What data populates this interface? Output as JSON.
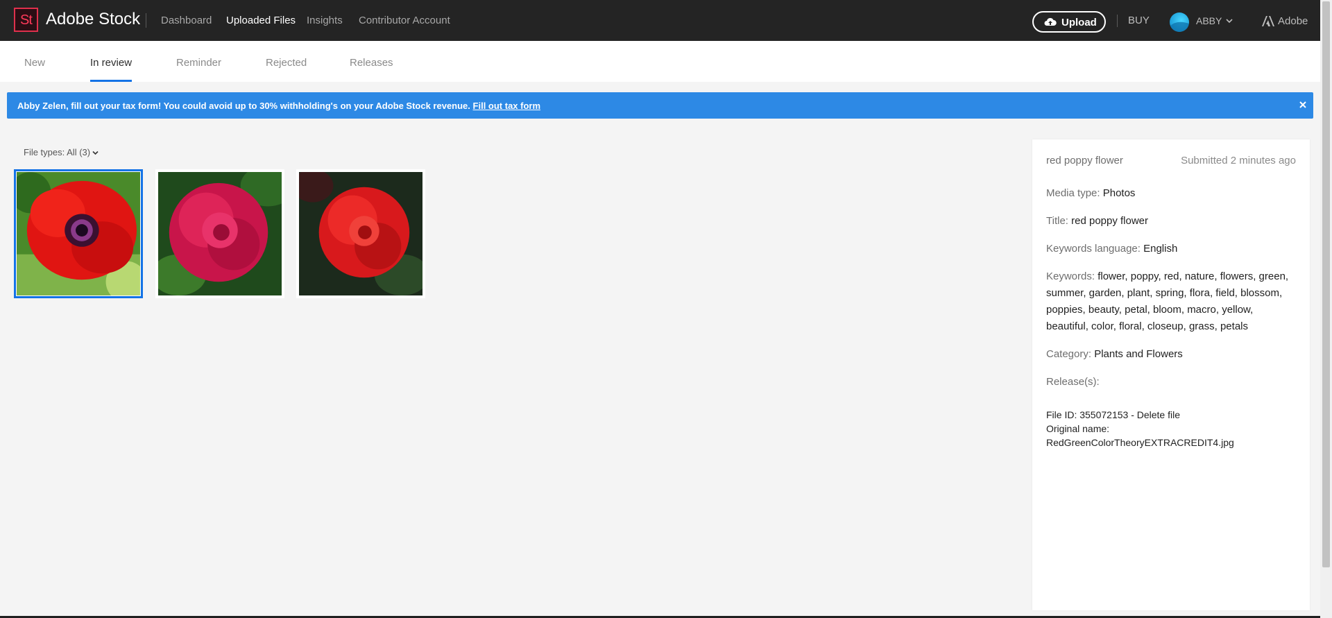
{
  "header": {
    "logo_text": "St",
    "brand": "Adobe Stock",
    "nav": [
      "Dashboard",
      "Uploaded Files",
      "Insights",
      "Contributor Account"
    ],
    "upload_label": "Upload",
    "buy_label": "BUY",
    "user_name": "ABBY",
    "adobe_label": "Adobe"
  },
  "tabs": [
    "New",
    "In review",
    "Reminder",
    "Rejected",
    "Releases"
  ],
  "banner": {
    "message": "Abby Zelen, fill out your tax form! You could avoid up to 30% withholding's on your Adobe Stock revenue.",
    "link": "Fill out tax form"
  },
  "filter": {
    "label": "File types: All (3)"
  },
  "thumbnails": [
    {
      "name": "red poppy flower",
      "selected": true
    },
    {
      "name": "pink rose",
      "selected": false
    },
    {
      "name": "red rose",
      "selected": false
    }
  ],
  "details": {
    "title": "red poppy flower",
    "submitted": "Submitted 2 minutes ago",
    "media_type_label": "Media type:",
    "media_type": "Photos",
    "title_label": "Title:",
    "title_value": "red poppy flower",
    "keywords_language_label": "Keywords language:",
    "keywords_language": "English",
    "keywords_label": "Keywords:",
    "keywords": "flower, poppy, red, nature, flowers, green, summer, garden, plant, spring, flora, field, blossom, poppies, beauty, petal, bloom, macro, yellow, beautiful, color, floral, closeup, grass, petals",
    "category_label": "Category:",
    "category": "Plants and Flowers",
    "releases_label": "Release(s):",
    "file_id": "File ID: 355072153 - ",
    "delete_label": "Delete file",
    "original_name_label": "Original name:",
    "original_name": "RedGreenColorTheoryEXTRACREDIT4.jpg"
  },
  "colors": {
    "topbar": "#242424",
    "accent": "#1473e6",
    "banner": "#2d89e5",
    "logo": "#e0304c"
  }
}
